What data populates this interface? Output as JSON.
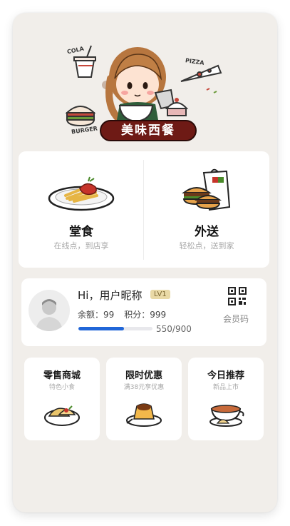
{
  "brand": {
    "name": "美味西餐"
  },
  "hero": {
    "cola_text": "COLA",
    "pizza_text": "PIZZA",
    "burger_text": "BURGER"
  },
  "order": {
    "dine_in": {
      "title": "堂食",
      "subtitle": "在线点，到店享",
      "icon": "pasta-plate-icon"
    },
    "delivery": {
      "title": "外送",
      "subtitle": "轻松点，送到家",
      "icon": "burger-bag-icon"
    }
  },
  "member": {
    "greeting": "Hi，用户昵称",
    "level": "LV1",
    "balance": "余额：99",
    "points": "积分：999",
    "progress_text": "550/900",
    "progress_value": 550,
    "progress_max": 900,
    "qr_label": "会员码",
    "accent": "#2066d8"
  },
  "tiles": [
    {
      "title": "零售商城",
      "subtitle": "特色小食",
      "icon": "snack-plate-icon"
    },
    {
      "title": "限时优惠",
      "subtitle": "满38元享优惠",
      "icon": "pudding-icon"
    },
    {
      "title": "今日推荐",
      "subtitle": "新品上市",
      "icon": "soup-bowl-icon"
    }
  ]
}
